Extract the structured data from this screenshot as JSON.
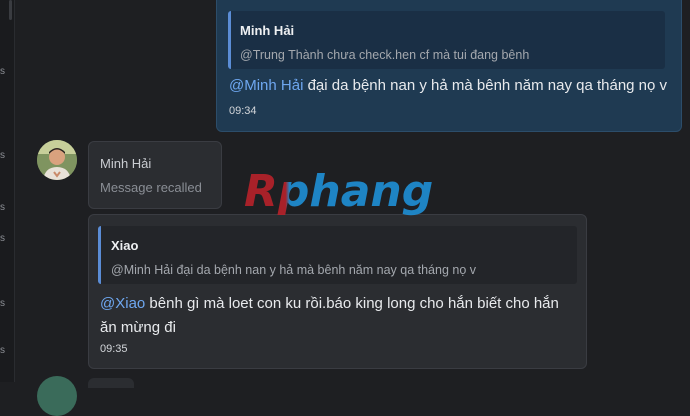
{
  "sidebar": {
    "glyphs": [
      "s",
      "s",
      "s",
      "s",
      "s",
      "s"
    ]
  },
  "messages": [
    {
      "quote": {
        "author": "Minh Hải",
        "text": "@Trung Thành chưa check.hen cf mà tui đang bênh"
      },
      "mention": "@Minh Hải",
      "text": " đại da bệnh nan y hả mà bênh năm nay qa tháng nọ v",
      "time": "09:34"
    },
    {
      "sender": "Minh Hải",
      "recalled_text": "Message recalled"
    },
    {
      "quote": {
        "author": "Xiao",
        "text": "@Minh Hải đại da bệnh nan y hả mà bênh năm nay qa tháng nọ v"
      },
      "mention": "@Xiao",
      "text": " bênh gì mà loet con ku rồi.báo king long cho hắn biết cho hắn ăn mừng đi",
      "time": "09:35"
    }
  ],
  "watermark": {
    "text": "Rphang",
    "colors": {
      "left": "#b8222a",
      "right": "#1e8fd6"
    }
  },
  "colors": {
    "background": "#1e1f22",
    "bubble": "#2b2d31",
    "own_bubble": "#1f3a52",
    "mention": "#6ea7f0",
    "quote_bar": "#5b8dd6"
  }
}
